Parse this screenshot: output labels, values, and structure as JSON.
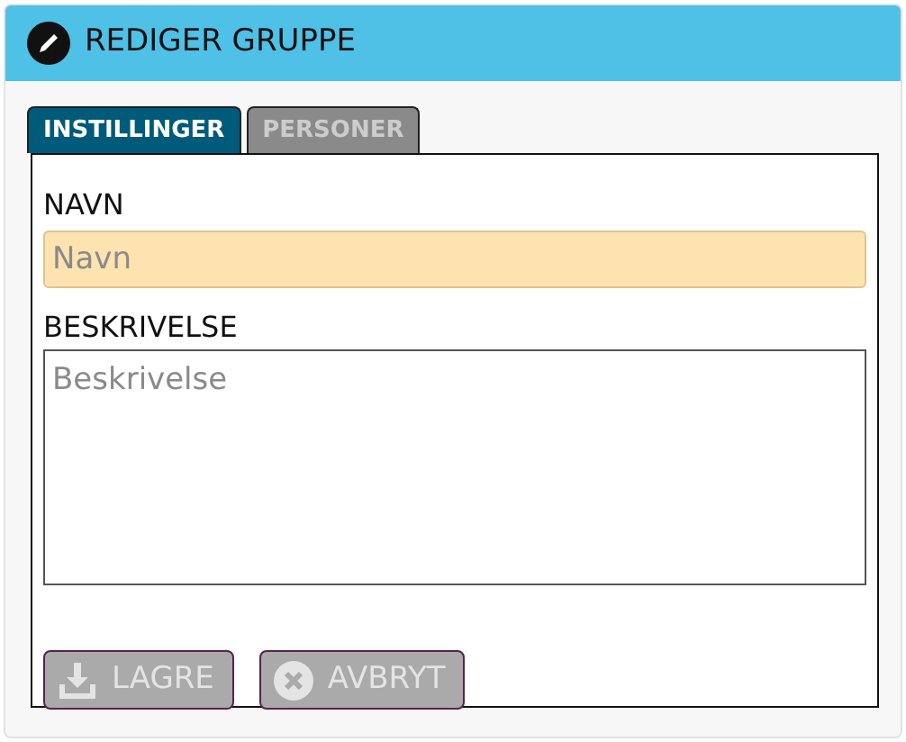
{
  "header": {
    "title": "REDIGER GRUPPE"
  },
  "tabs": [
    {
      "label": "INSTILLINGER",
      "selected": true
    },
    {
      "label": "PERSONER",
      "selected": false
    }
  ],
  "fields": [
    {
      "kind": "input",
      "label": "NAVN",
      "placeholder": "Navn"
    },
    {
      "kind": "textarea",
      "label": "BESKRIVELSE",
      "placeholder": "Beskrivelse"
    }
  ],
  "buttons": [
    {
      "kind": "save",
      "label": "LAGRE",
      "disabled": true
    },
    {
      "kind": "cancel",
      "label": "AVBRYT",
      "disabled": true
    }
  ]
}
